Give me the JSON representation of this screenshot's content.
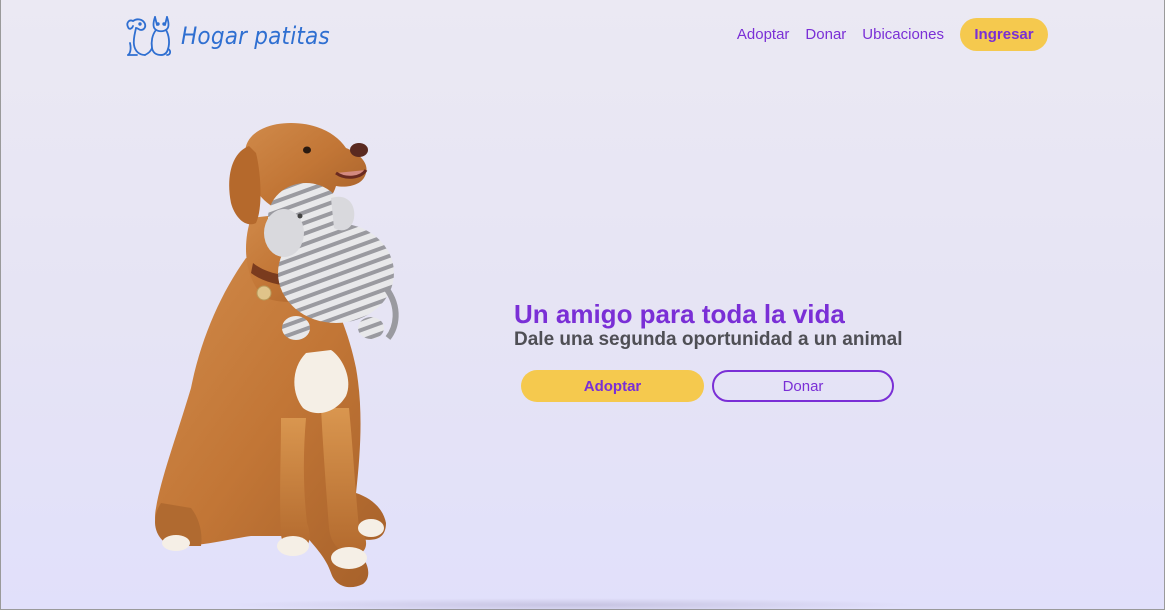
{
  "brand": {
    "name": "Hogar patitas",
    "logo_icon": "cat-and-dog-icon",
    "color": "#2f6fd1"
  },
  "nav": {
    "links": [
      "Adoptar",
      "Donar",
      "Ubicaciones"
    ],
    "login_label": "Ingresar"
  },
  "hero": {
    "title": "Un amigo para toda la vida",
    "subtitle": "Dale una segunda oportunidad a un animal",
    "primary_button": "Adoptar",
    "secondary_button": "Donar",
    "image": "dog-with-plush-toy-image"
  },
  "colors": {
    "accent": "#7a2fd6",
    "button_yellow": "#f5c94e",
    "background": "#e6e4f4",
    "subtitle": "#4f4f55"
  }
}
